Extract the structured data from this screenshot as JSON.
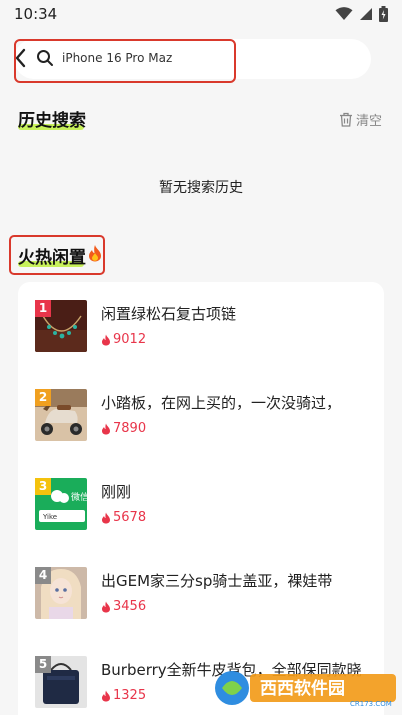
{
  "status_bar": {
    "time": "10:34"
  },
  "search": {
    "value": "iPhone 16 Pro Maz"
  },
  "history": {
    "title": "历史搜索",
    "clear_label": "清空",
    "empty_text": "暂无搜索历史"
  },
  "hot": {
    "title": "火热闲置",
    "title_emoji": "🔥",
    "items": [
      {
        "rank": "1",
        "title": "闲置绿松石复古项链",
        "heat": "9012",
        "rank_color": "#e8354a"
      },
      {
        "rank": "2",
        "title": "小踏板，在网上买的，一次没骑过，",
        "heat": "7890",
        "rank_color": "#f0a020"
      },
      {
        "rank": "3",
        "title": "刚刚",
        "heat": "5678",
        "rank_color": "#f4c20d"
      },
      {
        "rank": "4",
        "title": "出GEM家三分sp骑士盖亚，裸娃带",
        "heat": "3456",
        "rank_color": "#8a8a8a"
      },
      {
        "rank": "5",
        "title": "Burberry全新牛皮背包，全部保同款晓",
        "heat": "1325",
        "rank_color": "#8a8a8a"
      }
    ]
  },
  "watermark": {
    "brand": "西西软件园",
    "url": "CR173.COM"
  }
}
